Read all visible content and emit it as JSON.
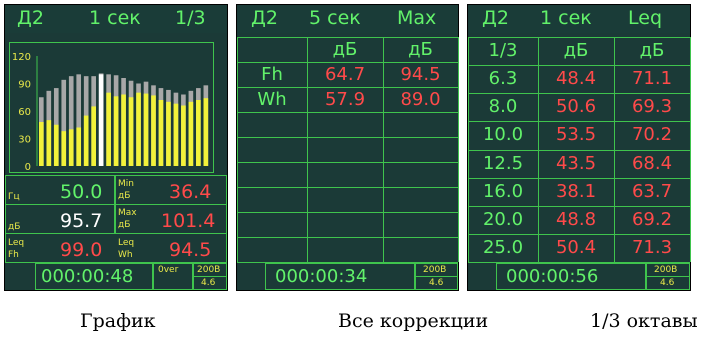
{
  "graph_screen": {
    "header": {
      "channel": "Д2",
      "interval": "1 сек",
      "mode": "1/3"
    },
    "chart_data": {
      "type": "bar",
      "ylim": [
        0,
        120
      ],
      "ytick_labels": [
        "120",
        "90",
        "60",
        "30",
        "0"
      ],
      "series": [
        {
          "values": [
            75,
            82,
            85,
            94,
            98,
            100,
            98,
            98,
            101,
            100,
            99,
            96,
            93,
            90,
            92,
            88,
            85,
            83,
            80,
            78,
            82,
            85,
            88
          ]
        },
        {
          "values": [
            48,
            50,
            45,
            38,
            40,
            42,
            55,
            65,
            100,
            80,
            76,
            78,
            75,
            80,
            79,
            77,
            72,
            70,
            68,
            66,
            70,
            72,
            74
          ]
        }
      ],
      "marker_index": 8
    },
    "readouts": {
      "freq_label": "Гц",
      "freq_value": "50.0",
      "min_label": "Min",
      "min_unit": "дБ",
      "min_value": "36.4",
      "db_label": "дБ",
      "level_value": "95.7",
      "max_label": "Max",
      "max_unit": "дБ",
      "max_value": "101.4",
      "leq_label": "Leq",
      "leq_corr": "Fh",
      "leq_value": "99.0",
      "leq2_label": "Leq",
      "leq2_corr": "Wh",
      "leq2_value": "94.5"
    },
    "footer": {
      "time": "000:00:48",
      "over": "0ver",
      "range": "200В",
      "battery": "4.6"
    }
  },
  "corrections_screen": {
    "header": {
      "channel": "Д2",
      "interval": "5 сек",
      "mode": "Max"
    },
    "columns": [
      "дБ",
      "дБ"
    ],
    "rows": [
      {
        "name": "Fh",
        "v1": "64.7",
        "v2": "94.5"
      },
      {
        "name": "Wh",
        "v1": "57.9",
        "v2": "89.0"
      }
    ],
    "footer": {
      "time": "000:00:34",
      "range": "200В",
      "battery": "4.6"
    }
  },
  "octave_screen": {
    "header": {
      "channel": "Д2",
      "interval": "1 сек",
      "mode": "Leq"
    },
    "columns": [
      "1/3",
      "дБ",
      "дБ"
    ],
    "rows": [
      {
        "f": "6.3",
        "v1": "48.4",
        "v2": "71.1"
      },
      {
        "f": "8.0",
        "v1": "50.6",
        "v2": "69.3"
      },
      {
        "f": "10.0",
        "v1": "53.5",
        "v2": "70.2"
      },
      {
        "f": "12.5",
        "v1": "43.5",
        "v2": "68.4"
      },
      {
        "f": "16.0",
        "v1": "38.1",
        "v2": "63.7"
      },
      {
        "f": "20.0",
        "v1": "48.8",
        "v2": "69.2"
      },
      {
        "f": "25.0",
        "v1": "50.4",
        "v2": "71.3"
      }
    ],
    "footer": {
      "time": "000:00:56",
      "range": "200В",
      "battery": "4.6"
    }
  },
  "captions": {
    "graph": "График",
    "corrections": "Все коррекции",
    "octave": "1/3 октавы"
  },
  "colors": {
    "screen_bg": "#1b3a37",
    "grid": "#3fc44d",
    "text_green": "#62f26a",
    "value_red": "#ff4a4a",
    "label_yellow": "#e8e84a",
    "bar_gray": "#a8a8a8",
    "bar_yellow": "#f2f23a",
    "marker": "#ffffff"
  }
}
